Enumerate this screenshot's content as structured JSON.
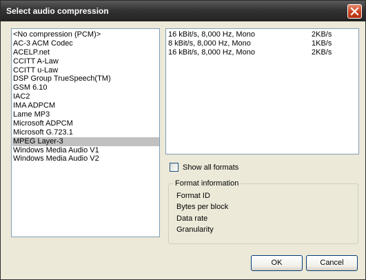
{
  "window": {
    "title": "Select audio compression",
    "close_icon": "close-icon"
  },
  "compressors": {
    "selected_index": 13,
    "items": [
      "<No compression (PCM)>",
      "AC-3 ACM Codec",
      "ACELP.net",
      "CCITT A-Law",
      "CCITT u-Law",
      "DSP Group TrueSpeech(TM)",
      "GSM 6.10",
      "IAC2",
      "IMA ADPCM",
      "Lame MP3",
      "Microsoft ADPCM",
      "Microsoft G.723.1",
      "MPEG Layer-3",
      "Windows Media Audio V1",
      "Windows Media Audio V2"
    ]
  },
  "formats": [
    {
      "format": "16 kBit/s, 8,000 Hz, Mono",
      "rate": "2KB/s"
    },
    {
      "format": "8 kBit/s, 8,000 Hz, Mono",
      "rate": "1KB/s"
    },
    {
      "format": "16 kBit/s, 8,000 Hz, Mono",
      "rate": "2KB/s"
    }
  ],
  "show_all_formats": {
    "label": "Show all formats",
    "checked": false
  },
  "format_info": {
    "title": "Format information",
    "labels": [
      "Format ID",
      "Bytes per block",
      "Data rate",
      "Granularity"
    ]
  },
  "buttons": {
    "ok": "OK",
    "cancel": "Cancel"
  },
  "colors": {
    "selection": "#c1c1c1",
    "dialog_bg": "#ece9d8",
    "titlebar": "#2f2f2f"
  }
}
